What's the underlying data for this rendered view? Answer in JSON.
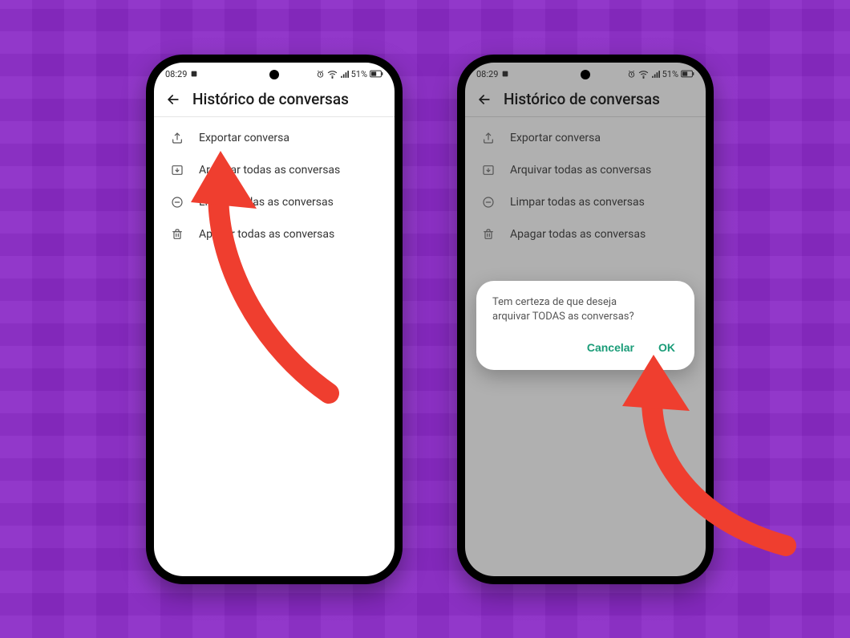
{
  "status_bar": {
    "time": "08:29",
    "battery_text": "51%"
  },
  "header": {
    "title": "Histórico de conversas"
  },
  "menu": {
    "export_label": "Exportar conversa",
    "archive_label": "Arquivar todas as conversas",
    "clear_label": "Limpar todas as conversas",
    "delete_label": "Apagar todas as conversas"
  },
  "dialog": {
    "message_line1": "Tem certeza de que deseja",
    "message_line2": "arquivar TODAS as conversas?",
    "cancel_label": "Cancelar",
    "ok_label": "OK"
  }
}
